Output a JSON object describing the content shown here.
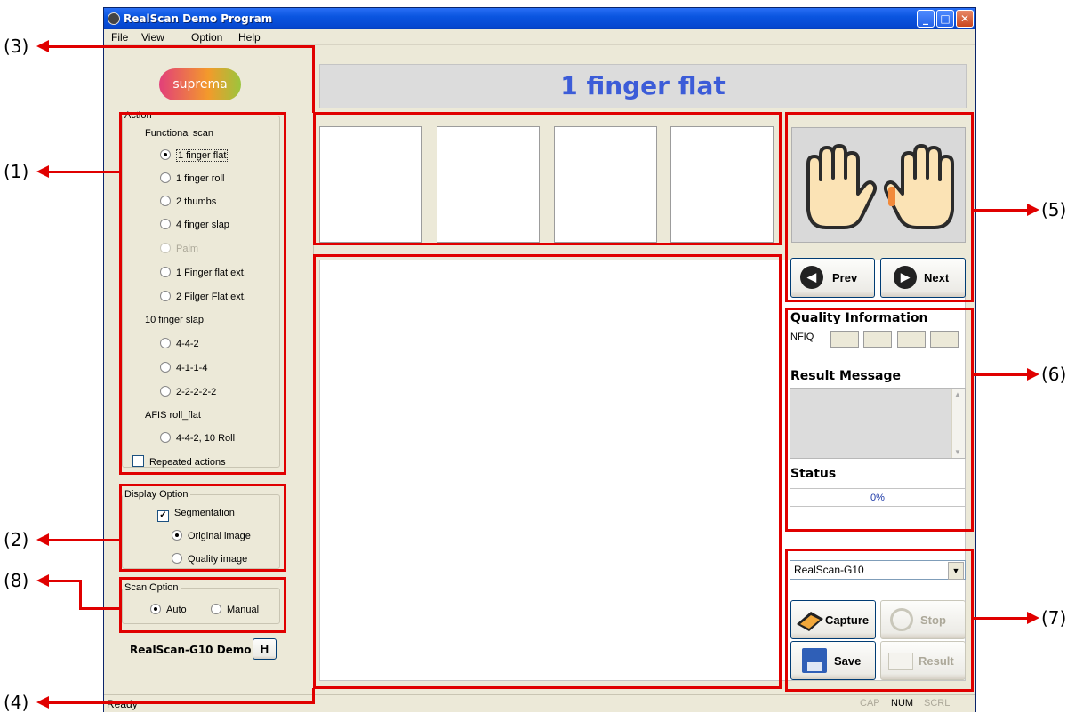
{
  "window": {
    "title": "RealScan Demo Program",
    "controls": {
      "minimize": "_",
      "maximize": "□",
      "close": "✕"
    }
  },
  "menu": [
    "File",
    "View",
    "Option",
    "Help"
  ],
  "logo": "suprema",
  "action": {
    "legend": "Action",
    "functional_title": "Functional scan",
    "functional": [
      "1 finger flat",
      "1 finger roll",
      "2 thumbs",
      "4 finger slap",
      "Palm",
      "1 Finger flat ext.",
      "2 Filger Flat ext."
    ],
    "slap_title": "10 finger slap",
    "slap": [
      "4-4-2",
      "4-1-1-4",
      "2-2-2-2-2"
    ],
    "afis_title": "AFIS roll_flat",
    "afis": [
      "4-4-2, 10 Roll"
    ],
    "repeated": "Repeated actions"
  },
  "display_option": {
    "legend": "Display Option",
    "segmentation": "Segmentation",
    "original": "Original image",
    "quality": "Quality image"
  },
  "scan_option": {
    "legend": "Scan Option",
    "auto": "Auto",
    "manual": "Manual"
  },
  "device_label": "RealScan-G10 Demo",
  "h_button": "H",
  "header": "1 finger flat",
  "nav": {
    "prev": "Prev",
    "next": "Next"
  },
  "quality": {
    "title": "Quality Information",
    "nfiq": "NFIQ"
  },
  "result": {
    "title": "Result Message"
  },
  "status": {
    "title": "Status",
    "progress": "0%",
    "progress_value": 0
  },
  "device_select": "RealScan-G10",
  "buttons": {
    "capture": "Capture",
    "stop": "Stop",
    "save": "Save",
    "result": "Result"
  },
  "statusbar": {
    "text": "Ready",
    "cap": "CAP",
    "num": "NUM",
    "scrl": "SCRL"
  },
  "annotations": [
    "(1)",
    "(2)",
    "(3)",
    "(4)",
    "(5)",
    "(6)",
    "(7)",
    "(8)"
  ],
  "colors": {
    "annotation": "#e00000",
    "header_text": "#3c5cd8",
    "titlebar": "#0a55e0"
  }
}
